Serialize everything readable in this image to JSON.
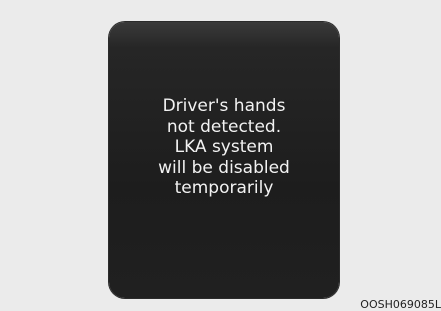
{
  "display": {
    "message_lines": [
      "Driver's hands",
      "not detected.",
      "LKA system",
      "will be disabled",
      "temporarily"
    ]
  },
  "figure": {
    "code": "OOSH069085L"
  },
  "colors": {
    "page_background": "#ebebeb",
    "screen_background": "#1d1d1d",
    "message_text": "#f2f2f2"
  }
}
